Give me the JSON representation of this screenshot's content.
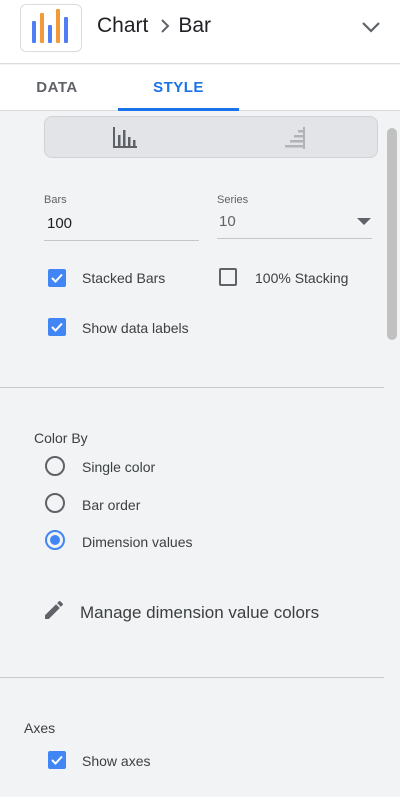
{
  "header": {
    "breadcrumb_parent": "Chart",
    "breadcrumb_current": "Bar",
    "logo_colors": [
      "#f29a38",
      "#4f7ff2"
    ]
  },
  "tabs": [
    {
      "label": "DATA",
      "active": false
    },
    {
      "label": "STYLE",
      "active": true
    }
  ],
  "chart_orientation": {
    "options": [
      "vertical-bars-icon",
      "horizontal-bars-icon"
    ],
    "selected": "vertical-bars-icon"
  },
  "bars_field": {
    "label": "Bars",
    "value": "100"
  },
  "series_field": {
    "label": "Series",
    "value": "10"
  },
  "checkboxes": {
    "stacked_bars": {
      "label": "Stacked Bars",
      "checked": true
    },
    "percent_stacking": {
      "label": "100% Stacking",
      "checked": false
    },
    "show_data_labels": {
      "label": "Show data labels",
      "checked": true
    }
  },
  "color_by": {
    "title": "Color By",
    "options": [
      {
        "label": "Single color",
        "selected": false
      },
      {
        "label": "Bar order",
        "selected": false
      },
      {
        "label": "Dimension values",
        "selected": true
      }
    ],
    "manage_label": "Manage dimension value colors"
  },
  "axes": {
    "title": "Axes",
    "show_axes": {
      "label": "Show axes",
      "checked": true
    }
  },
  "colors": {
    "accent": "#1a73e8",
    "checkbox": "#4285f4"
  }
}
